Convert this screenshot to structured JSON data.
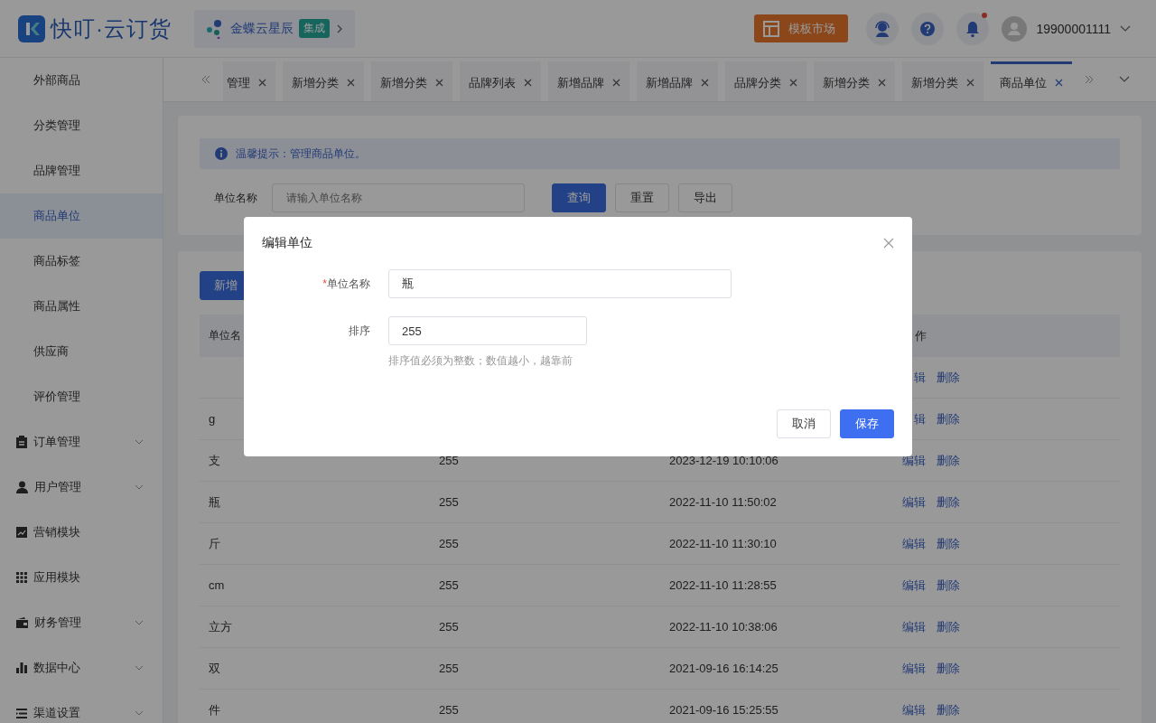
{
  "header": {
    "logo_text": "快叮·云订货",
    "integration": {
      "name": "金蝶云星辰",
      "badge": "集成"
    },
    "template_button": "模板市场",
    "notification_dot": true,
    "user": "19900001111"
  },
  "sidebar": {
    "items": [
      {
        "label": "外部商品",
        "kind": "sub",
        "selected": false
      },
      {
        "label": "分类管理",
        "kind": "sub",
        "selected": false
      },
      {
        "label": "品牌管理",
        "kind": "sub",
        "selected": false
      },
      {
        "label": "商品单位",
        "kind": "sub",
        "selected": true
      },
      {
        "label": "商品标签",
        "kind": "sub",
        "selected": false
      },
      {
        "label": "商品属性",
        "kind": "sub",
        "selected": false
      },
      {
        "label": "供应商",
        "kind": "sub",
        "selected": false
      },
      {
        "label": "评价管理",
        "kind": "sub",
        "selected": false
      },
      {
        "label": "订单管理",
        "kind": "group",
        "expandable": true,
        "selected": false
      },
      {
        "label": "用户管理",
        "kind": "group",
        "expandable": true,
        "selected": false
      },
      {
        "label": "营销模块",
        "kind": "group",
        "expandable": false,
        "selected": false
      },
      {
        "label": "应用模块",
        "kind": "group",
        "expandable": false,
        "selected": false
      },
      {
        "label": "财务管理",
        "kind": "group",
        "expandable": true,
        "selected": false
      },
      {
        "label": "数据中心",
        "kind": "group",
        "expandable": true,
        "selected": false
      },
      {
        "label": "渠道设置",
        "kind": "group",
        "expandable": true,
        "selected": false
      }
    ]
  },
  "tabs": [
    {
      "label": "管理",
      "selected": false
    },
    {
      "label": "新增分类",
      "selected": false
    },
    {
      "label": "新增分类",
      "selected": false
    },
    {
      "label": "品牌列表",
      "selected": false
    },
    {
      "label": "新增品牌",
      "selected": false
    },
    {
      "label": "新增品牌",
      "selected": false
    },
    {
      "label": "品牌分类",
      "selected": false
    },
    {
      "label": "新增分类",
      "selected": false
    },
    {
      "label": "新增分类",
      "selected": false
    },
    {
      "label": "商品单位",
      "selected": true
    }
  ],
  "notice": "温馨提示：管理商品单位。",
  "search": {
    "label": "单位名称",
    "placeholder": "请输入单位名称",
    "buttons": [
      "查询",
      "重置",
      "导出"
    ]
  },
  "add_button": "新增",
  "table": {
    "columns": [
      "单位名",
      "作"
    ],
    "rows": [
      {
        "name": "",
        "actions": [
          "辑",
          "删除"
        ]
      },
      {
        "name": "g",
        "actions": [
          "辑",
          "删除"
        ]
      },
      {
        "name": "支",
        "sort": "255",
        "time": "2023-12-19 10:10:06",
        "actions": [
          "编辑",
          "删除"
        ]
      },
      {
        "name": "瓶",
        "sort": "255",
        "time": "2022-11-10 11:50:02",
        "actions": [
          "编辑",
          "删除"
        ]
      },
      {
        "name": "斤",
        "sort": "255",
        "time": "2022-11-10 11:30:10",
        "actions": [
          "编辑",
          "删除"
        ]
      },
      {
        "name": "cm",
        "sort": "255",
        "time": "2022-11-10 11:28:55",
        "actions": [
          "编辑",
          "删除"
        ]
      },
      {
        "name": "立方",
        "sort": "255",
        "time": "2022-11-10 10:38:06",
        "actions": [
          "编辑",
          "删除"
        ]
      },
      {
        "name": "双",
        "sort": "255",
        "time": "2021-09-16 16:14:25",
        "actions": [
          "编辑",
          "删除"
        ]
      },
      {
        "name": "件",
        "sort": "255",
        "time": "2021-09-16 15:25:55",
        "actions": [
          "编辑",
          "删除"
        ]
      }
    ]
  },
  "dialog": {
    "title": "编辑单位",
    "fields": [
      {
        "label": "单位名称",
        "required_mark": "*",
        "value": "瓶"
      },
      {
        "label": "排序",
        "value": "255",
        "hint": "排序值必须为整数；数值越小，越靠前"
      }
    ],
    "buttons": [
      {
        "label": "取消",
        "kind": "default"
      },
      {
        "label": "保存",
        "kind": "primary"
      }
    ]
  }
}
